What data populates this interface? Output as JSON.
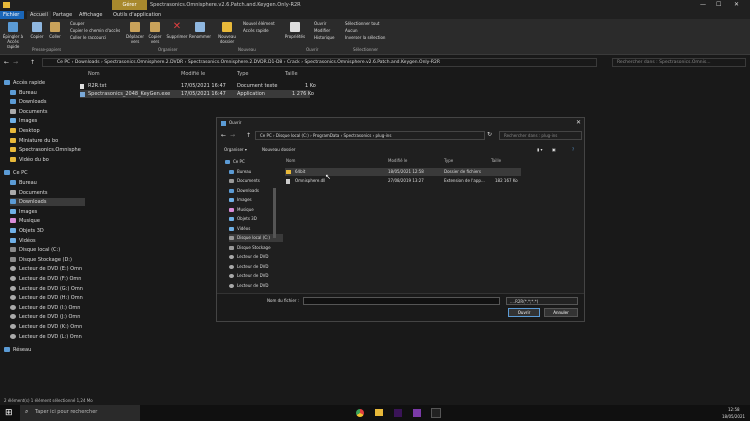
{
  "window": {
    "title": "Spectrasonics.Omnisphere.v2.6.Patch.and.Keygen.Only-R2R",
    "active_group": "Gérer",
    "active_group_sub": "Outils d'application"
  },
  "tabs": [
    "Fichier",
    "Accueil",
    "Partage",
    "Affichage"
  ],
  "ribbon": {
    "buttons": [
      {
        "label": "Épingler à Accès rapide"
      },
      {
        "label": "Copier"
      },
      {
        "label": "Coller"
      },
      {
        "label": "Déplacer vers"
      },
      {
        "label": "Copier vers"
      },
      {
        "label": "Supprimer"
      },
      {
        "label": "Renommer"
      },
      {
        "label": "Nouveau dossier"
      },
      {
        "label": "Propriétés"
      }
    ],
    "small": {
      "couper": "Couper",
      "copier_chemin": "Copier le chemin d'accès",
      "coller_raccourci": "Coller le raccourci",
      "nouvel_element": "Nouvel élément",
      "acces_rapide": "Accès rapide",
      "ouvrir": "Ouvrir",
      "modifier": "Modifier",
      "historique": "Historique",
      "sel_tout": "Sélectionner tout",
      "aucun": "Aucun",
      "inverser": "Inverser la sélection"
    },
    "groups": [
      "Presse-papiers",
      "Organiser",
      "Nouveau",
      "Ouvrir",
      "Sélectionner"
    ]
  },
  "address": {
    "path": "Ce PC  ›  Downloads  ›  Spectrasonics.Omnisphere.2.DVDR  ›  Spectrasonics.Omnisphere.2.DVDR.D1-D8  ›  Crack  ›  Spectrasonics.Omnisphere.v2.6.Patch.and.Keygen.Only-R2R",
    "search_placeholder": "Rechercher dans : Spectrasonics.Omnis..."
  },
  "nav": {
    "items": [
      "Accès rapide",
      "Bureau",
      "Downloads",
      "Documents",
      "Images",
      "Desktop",
      "Miniature du bo",
      "Spectrasonics.Omnisphe",
      "Vidéo du bo",
      "Ce PC",
      "Bureau",
      "Documents",
      "Downloads",
      "Images",
      "Musique",
      "Objets 3D",
      "Vidéos",
      "Disque local (C:)",
      "Disque Stockage (D:)",
      "Lecteur de DVD (E:) Omn",
      "Lecteur de DVD (F:) Omn",
      "Lecteur de DVD (G:) Omn",
      "Lecteur de DVD (H:) Omn",
      "Lecteur de DVD (I:) Omn",
      "Lecteur de DVD (J:) Omn",
      "Lecteur de DVD (K:) Omn",
      "Lecteur de DVD (L:) Omn",
      "Réseau"
    ]
  },
  "columns": [
    "Nom",
    "Modifié le",
    "Type",
    "Taille"
  ],
  "files": [
    {
      "name": "R2R.txt",
      "date": "17/05/2021 16:47",
      "type": "Document texte",
      "size": "1 Ko"
    },
    {
      "name": "Spectrasonics_2048_KeyGen.exe",
      "date": "17/05/2021 16:47",
      "type": "Application",
      "size": "1 276 Ko"
    }
  ],
  "status": "2 élément(s)    1 élément sélectionné  1,24 Mo",
  "dialog": {
    "title": "Ouvrir",
    "path": "Ce PC  ›  Disque local (C:)  ›  ProgramData  ›  Spectrasonics  ›  plug-ins",
    "search_placeholder": "Rechercher dans : plug-ins",
    "organiser": "Organiser ▾",
    "nouveau_dossier": "Nouveau dossier",
    "columns": [
      "Nom",
      "Modifié le",
      "Type",
      "Taille"
    ],
    "files": [
      {
        "name": "64bit",
        "date": "18/05/2021 12:58",
        "type": "Dossier de fichiers",
        "size": ""
      },
      {
        "name": "Omnisphere.dll",
        "date": "27/08/2019 13:27",
        "type": "Extension de l'app...",
        "size": "182 167 Ko"
      }
    ],
    "nav": [
      "Ce PC",
      "Bureau",
      "Documents",
      "Downloads",
      "Images",
      "Musique",
      "Objets 3D",
      "Vidéos",
      "Disque local (C:)",
      "Disque Stockage",
      "Lecteur de DVD",
      "Lecteur de DVD",
      "Lecteur de DVD",
      "Lecteur de DVD"
    ],
    "filename_label": "Nom du fichier :",
    "filter": "....R2R(*.*;*.*)",
    "ok": "Ouvrir",
    "cancel": "Annuler"
  },
  "taskbar": {
    "search": "Taper ici pour rechercher",
    "time": "12:58",
    "date": "18/05/2021"
  }
}
